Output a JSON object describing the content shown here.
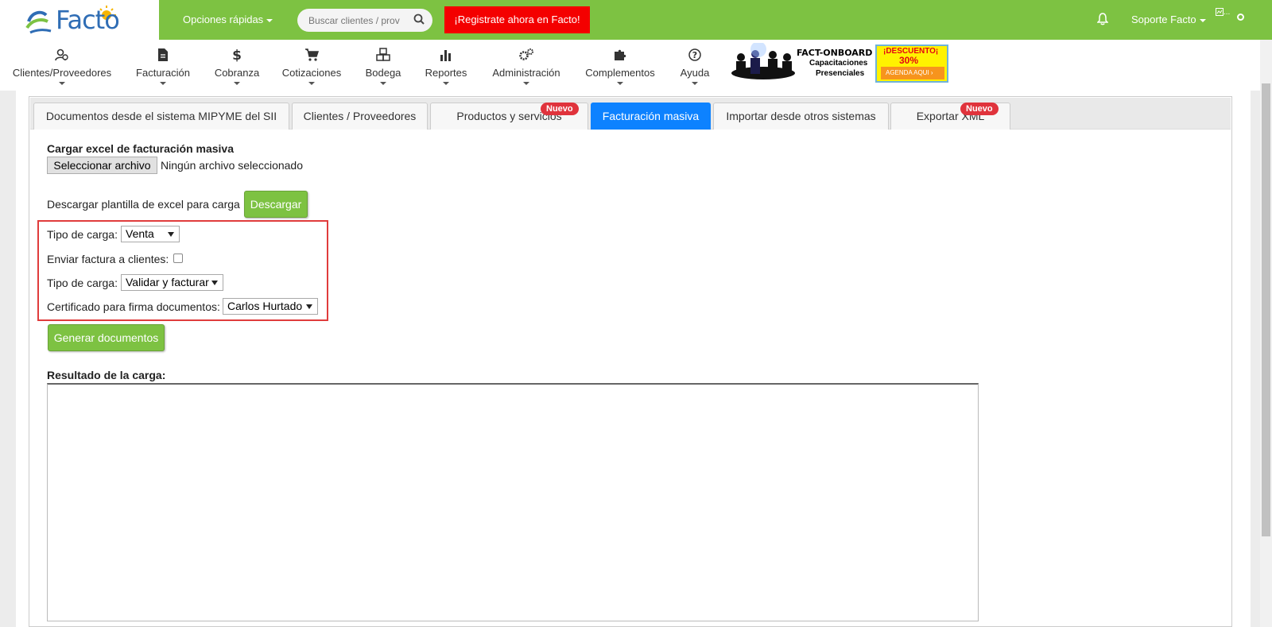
{
  "brand": {
    "name": "Facto",
    "accent": "#7dc242",
    "logo_blue": "#2f6db5",
    "logo_sun": "#f7b500"
  },
  "header": {
    "quick_options": "Opciones rápidas",
    "search_placeholder": "Buscar clientes / proveedores",
    "register_cta": "¡Registrate ahora en Facto!",
    "user_name": "Soporte Facto",
    "avatar_alt": "..."
  },
  "nav": [
    {
      "label": "Clientes/Proveedores",
      "icon": "clients-icon"
    },
    {
      "label": "Facturación",
      "icon": "document-icon"
    },
    {
      "label": "Cobranza",
      "icon": "dollar-icon"
    },
    {
      "label": "Cotizaciones",
      "icon": "cart-icon"
    },
    {
      "label": "Bodega",
      "icon": "boxes-icon"
    },
    {
      "label": "Reportes",
      "icon": "bar-chart-icon"
    },
    {
      "label": "Administración",
      "icon": "gears-icon"
    },
    {
      "label": "Complementos",
      "icon": "puzzle-icon"
    },
    {
      "label": "Ayuda",
      "icon": "question-icon"
    }
  ],
  "banner": {
    "title": "FACT-ONBOARD",
    "line2": "Capacitaciones",
    "line3": "Presenciales",
    "discount_label": "¡DESCUENTO¡",
    "discount_value": "30%",
    "cta": "AGENDA AQUI"
  },
  "tabs": [
    {
      "label": "Documentos desde el sistema MIPYME del SII",
      "active": false
    },
    {
      "label": "Clientes / Proveedores",
      "active": false
    },
    {
      "label": "Productos y servicios",
      "active": false,
      "badge": "Nuevo"
    },
    {
      "label": "Facturación masiva",
      "active": true
    },
    {
      "label": "Importar desde otros sistemas",
      "active": false
    },
    {
      "label": "Exportar XML",
      "active": false,
      "badge": "Nuevo"
    }
  ],
  "form": {
    "upload_title": "Cargar excel de facturación masiva",
    "file_button": "Seleccionar archivo",
    "file_status": "Ningún archivo seleccionado",
    "template_label": "Descargar plantilla de excel para carga",
    "download_button": "Descargar",
    "load_type_label": "Tipo de carga:",
    "load_type_value": "Venta",
    "send_invoice_label": "Enviar factura a clientes:",
    "send_invoice_checked": false,
    "load_type2_label": "Tipo de carga:",
    "load_type2_value": "Validar y facturar",
    "certificate_label": "Certificado para firma documentos:",
    "certificate_value": "Carlos Hurtado",
    "generate_button": "Generar documentos",
    "result_label": "Resultado de la carga:",
    "result_value": ""
  }
}
